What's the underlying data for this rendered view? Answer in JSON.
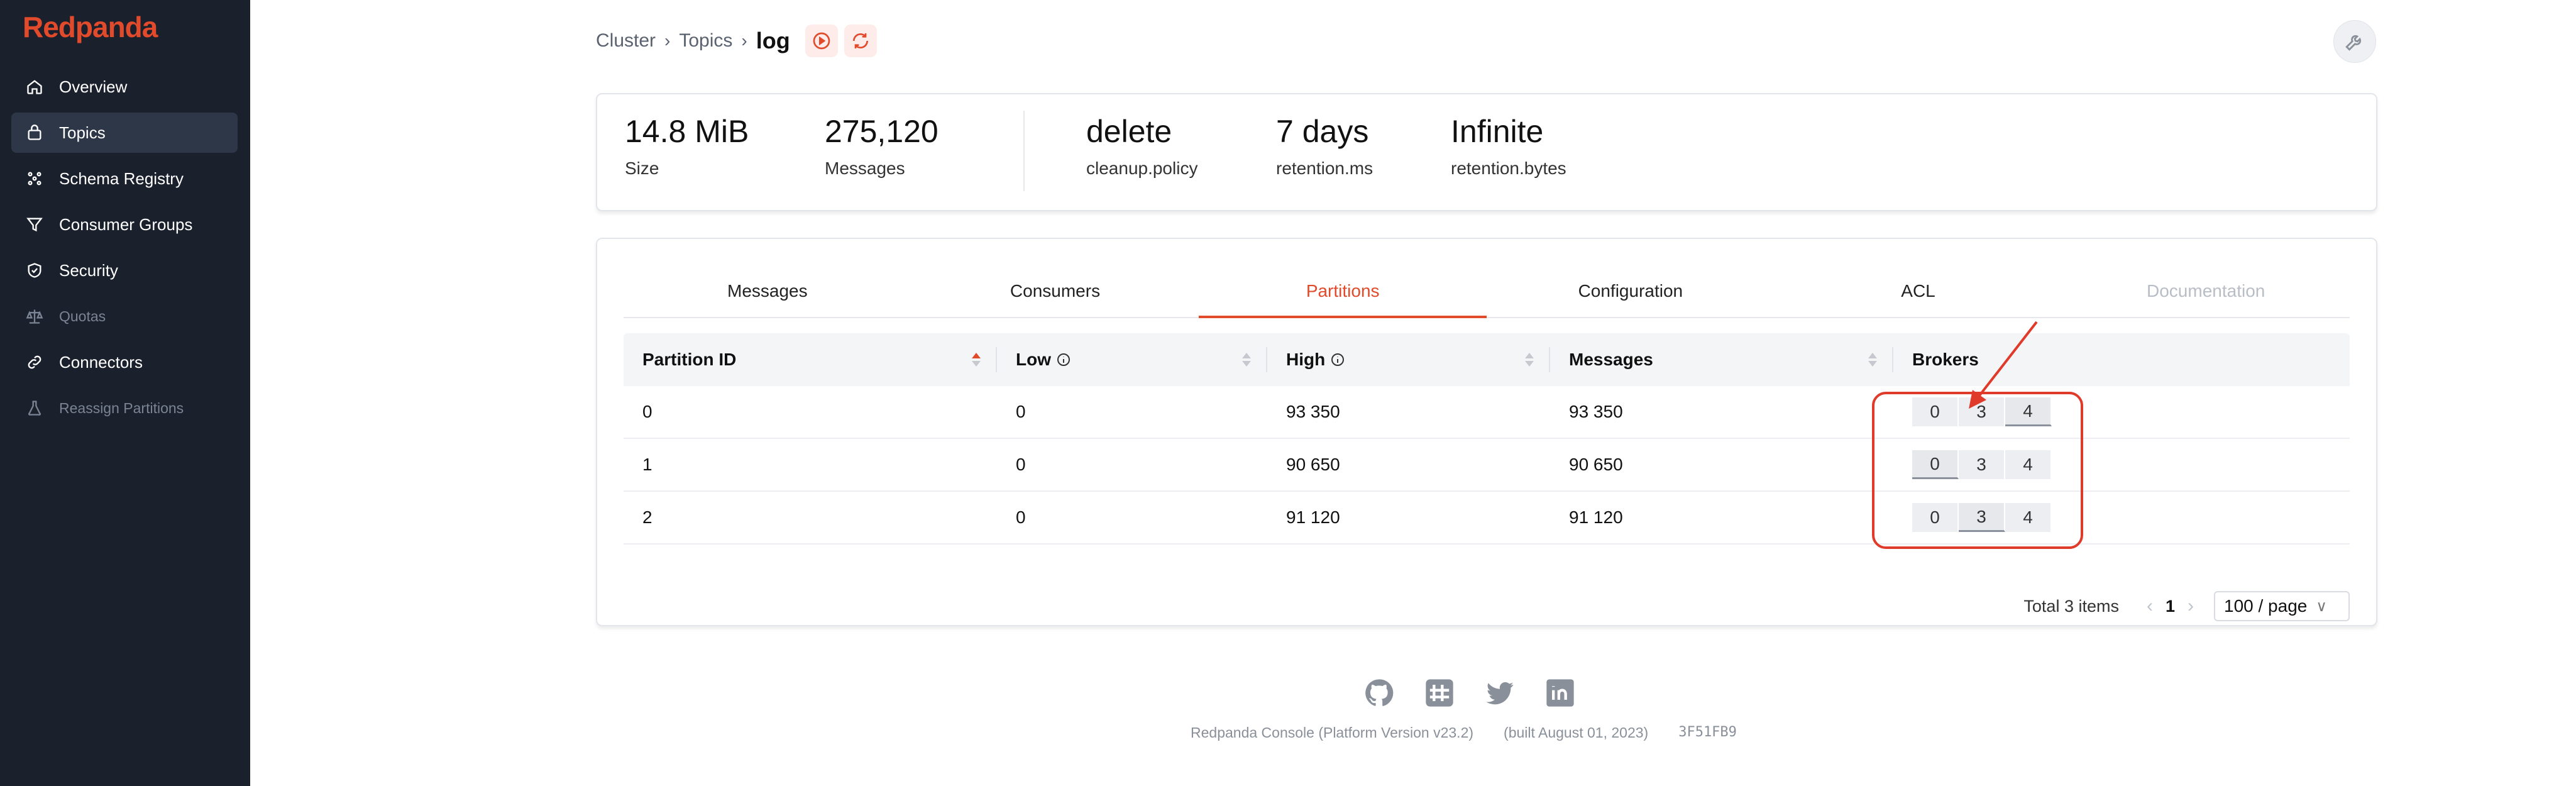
{
  "app": {
    "brand": "Redpanda"
  },
  "sidebar": {
    "items": [
      {
        "label": "Overview",
        "icon": "home-icon",
        "active": false,
        "disabled": false
      },
      {
        "label": "Topics",
        "icon": "topics-icon",
        "active": true,
        "disabled": false
      },
      {
        "label": "Schema Registry",
        "icon": "schema-icon",
        "active": false,
        "disabled": false
      },
      {
        "label": "Consumer Groups",
        "icon": "filter-icon",
        "active": false,
        "disabled": false
      },
      {
        "label": "Security",
        "icon": "shield-icon",
        "active": false,
        "disabled": false
      },
      {
        "label": "Quotas",
        "icon": "scale-icon",
        "active": false,
        "disabled": true
      },
      {
        "label": "Connectors",
        "icon": "link-icon",
        "active": false,
        "disabled": false
      },
      {
        "label": "Reassign Partitions",
        "icon": "beaker-icon",
        "active": false,
        "disabled": true
      }
    ]
  },
  "breadcrumb": {
    "items": [
      "Cluster",
      "Topics"
    ],
    "current": "log"
  },
  "stats": [
    {
      "value": "14.8 MiB",
      "label": "Size"
    },
    {
      "value": "275,120",
      "label": "Messages"
    },
    {
      "value": "delete",
      "label": "cleanup.policy"
    },
    {
      "value": "7 days",
      "label": "retention.ms"
    },
    {
      "value": "Infinite",
      "label": "retention.bytes"
    }
  ],
  "tabs": [
    {
      "label": "Messages",
      "state": "normal"
    },
    {
      "label": "Consumers",
      "state": "normal"
    },
    {
      "label": "Partitions",
      "state": "active"
    },
    {
      "label": "Configuration",
      "state": "normal"
    },
    {
      "label": "ACL",
      "state": "normal"
    },
    {
      "label": "Documentation",
      "state": "disabled"
    }
  ],
  "table": {
    "columns": [
      "Partition ID",
      "Low",
      "High",
      "Messages",
      "Brokers"
    ],
    "rows": [
      {
        "id": "0",
        "low": "0",
        "high": "93 350",
        "messages": "93 350",
        "brokers": [
          "0",
          "3",
          "4"
        ],
        "leader": 2
      },
      {
        "id": "1",
        "low": "0",
        "high": "90 650",
        "messages": "90 650",
        "brokers": [
          "0",
          "3",
          "4"
        ],
        "leader": 0
      },
      {
        "id": "2",
        "low": "0",
        "high": "91 120",
        "messages": "91 120",
        "brokers": [
          "0",
          "3",
          "4"
        ],
        "leader": 1
      }
    ]
  },
  "pagination": {
    "total": "Total 3 items",
    "page": "1",
    "page_size": "100 / page"
  },
  "footer": {
    "version": "Redpanda Console (Platform Version v23.2)",
    "built": "(built August 01, 2023)",
    "hash": "3F51FB9"
  },
  "colors": {
    "accent": "#e14a2b",
    "sidebar_bg": "#1a202c",
    "annotation": "#e03a2b"
  }
}
